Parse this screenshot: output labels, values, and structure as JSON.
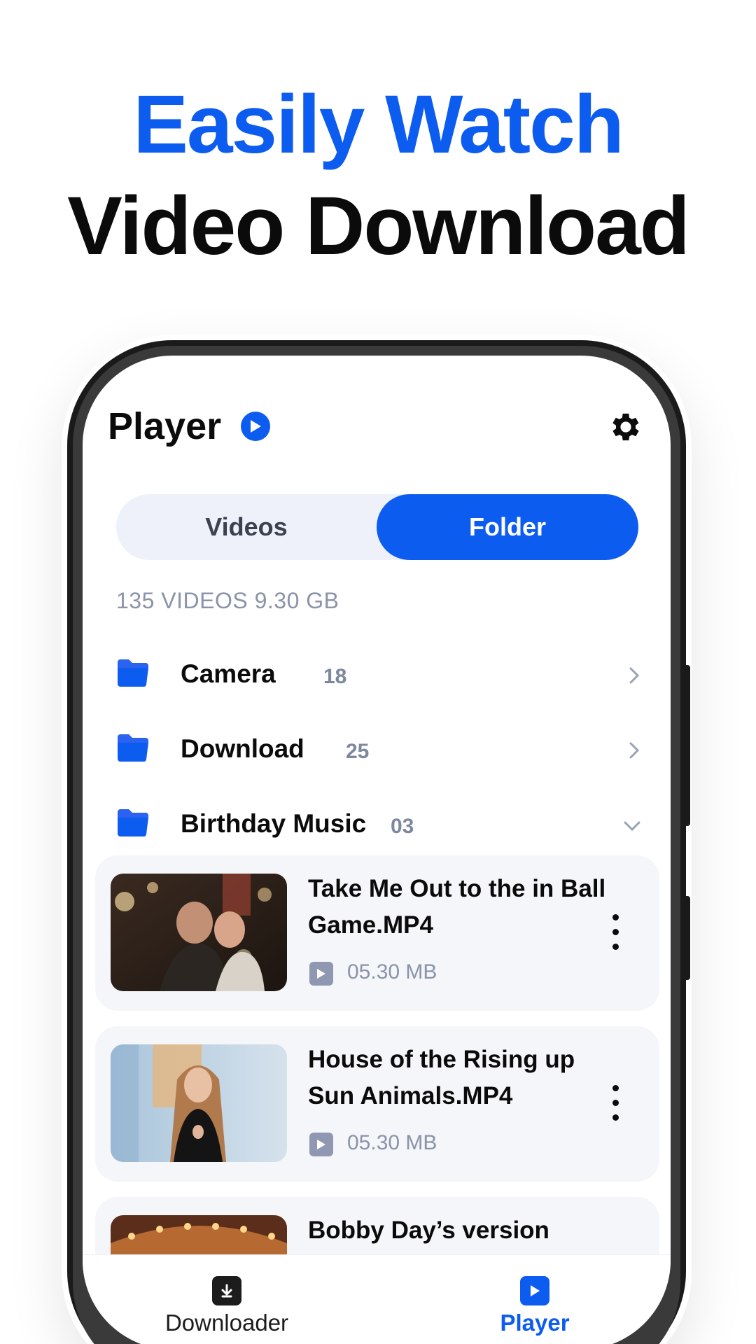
{
  "promo": {
    "line1": "Easily Watch",
    "line2": "Video Download"
  },
  "app": {
    "title": "Player",
    "settings_icon": "gear-icon",
    "accent": "#0d5cf0"
  },
  "tabs": [
    {
      "label": "Videos",
      "active": false
    },
    {
      "label": "Folder",
      "active": true
    }
  ],
  "summary": "135 VIDEOS 9.30 GB",
  "folders": [
    {
      "name": "Camera",
      "count": "18",
      "expanded": false
    },
    {
      "name": "Download",
      "count": "25",
      "expanded": false
    },
    {
      "name": "Birthday Music",
      "count": "03",
      "expanded": true
    }
  ],
  "videos": [
    {
      "title": "Take Me Out to the in Ball Game.MP4",
      "size": "05.30 MB"
    },
    {
      "title": "House of the Rising up Sun Animals.MP4",
      "size": "05.30 MB"
    },
    {
      "title": "Bobby Day’s version",
      "size": ""
    }
  ],
  "bottom_nav": [
    {
      "label": "Downloader",
      "icon": "download-icon",
      "active": false
    },
    {
      "label": "Player",
      "icon": "play-icon",
      "active": true
    }
  ]
}
